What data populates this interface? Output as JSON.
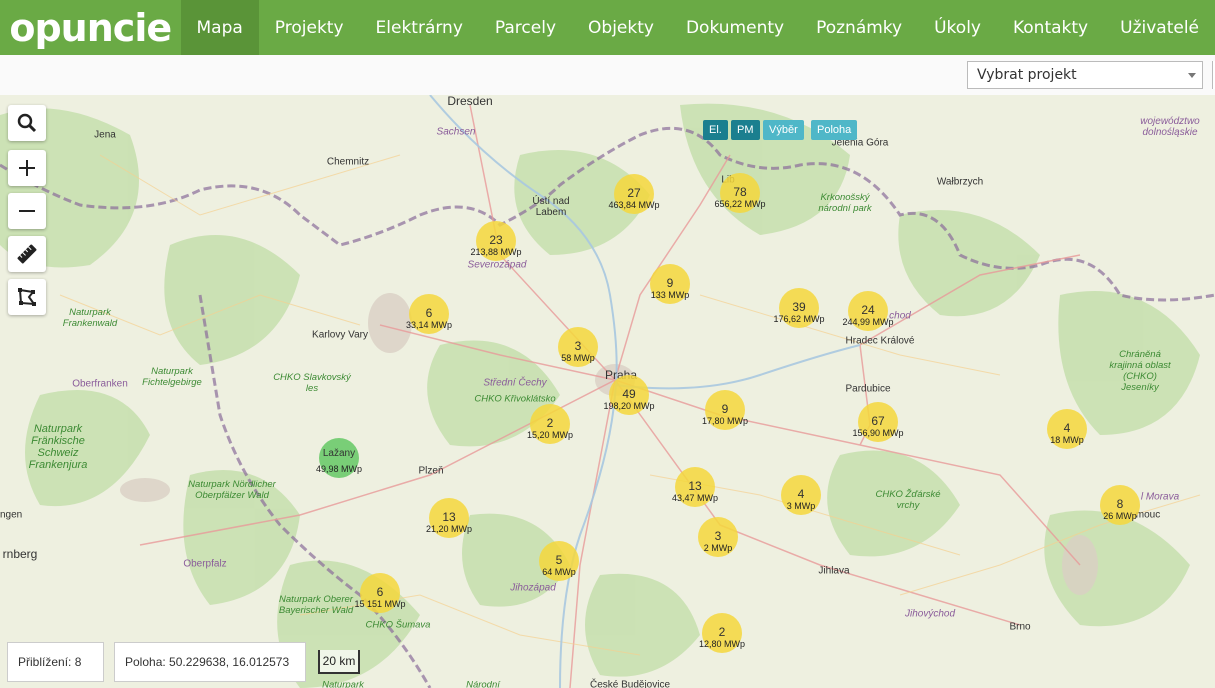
{
  "app": {
    "logo": "opuncie"
  },
  "nav": {
    "items": [
      "Mapa",
      "Projekty",
      "Elektrárny",
      "Parcely",
      "Objekty",
      "Dokumenty",
      "Poznámky",
      "Úkoly",
      "Kontakty",
      "Uživatelé"
    ],
    "active": "Mapa"
  },
  "project_select": {
    "value": "Vybrat projekt"
  },
  "layers": {
    "el": "El.",
    "pm": "PM",
    "vyber": "Výběr",
    "poloha": "Poloha"
  },
  "places": {
    "dresden": "Dresden",
    "chemnitz": "Chemnitz",
    "jena": "Jena",
    "usti": "Ústí nad Labem",
    "karlovy_vary": "Karlovy Vary",
    "praha": "Praha",
    "plzen": "Plzeň",
    "pardubice": "Pardubice",
    "hradec": "Hradec Králové",
    "jihlava": "Jihlava",
    "brno": "Brno",
    "walbrzych": "Wałbrzych",
    "jelenia": "Jelenia Góra",
    "oberfranken": "Oberfranken",
    "oberpfalz": "Oberpfalz",
    "rnberg": "rnberg",
    "ringen": "ringen",
    "ingen": "ingen",
    "ceske": "České Budějovice",
    "dolno": "województwo dolnośląskie",
    "severozapad": "Severozápad",
    "sachsen": "Sachsen",
    "stredni": "Střední Čechy",
    "jihozapad": "Jihozápad",
    "jihovychod": "Jihovýchod",
    "morava": "l Morava",
    "olomouc": "mouc",
    "liberec": "Lib",
    "chod": "chod",
    "narodni": "Národní"
  },
  "areas": {
    "frankenwald": "Naturpark Frankenwald",
    "fichtelgebirge": "Naturpark Fichtelgebirge",
    "slavkovsky": "CHKO Slavkovský les",
    "krivoklatsko": "CHKO Křivoklátsko",
    "krkonosssky": "Krkonošský národní park",
    "schweiz": "Naturpark Fränkische Schweiz Frankenjura",
    "nordl": "Naturpark Nördlicher Oberpfälzer Wald",
    "oberer": "Naturpark Oberer Bayerischer Wald",
    "sumava": "CHKO Šumava",
    "zdarske": "CHKO Žďárské vrchy",
    "jeseniky": "Chráněná krajinná oblast (CHKO) Jeseníky",
    "naturpark_bottom": "Naturpark"
  },
  "clusters": [
    {
      "count": "27",
      "power": "463,84 MWp"
    },
    {
      "count": "78",
      "power": "656,22 MWp"
    },
    {
      "count": "23",
      "power": "213,88 MWp"
    },
    {
      "count": "9",
      "power": "133 MWp"
    },
    {
      "count": "39",
      "power": "176,62 MWp"
    },
    {
      "count": "24",
      "power": "244,99 MWp"
    },
    {
      "count": "6",
      "power": "33,14 MWp"
    },
    {
      "count": "3",
      "power": "58 MWp"
    },
    {
      "count": "49",
      "power": "198,20 MWp"
    },
    {
      "count": "2",
      "power": "15,20 MWp"
    },
    {
      "count": "9",
      "power": "17,80 MWp"
    },
    {
      "count": "67",
      "power": "156,90 MWp"
    },
    {
      "count": "4",
      "power": "18 MWp"
    },
    {
      "count": "Lažany",
      "power": "49,98 MWp"
    },
    {
      "count": "13",
      "power": "43,47 MWp"
    },
    {
      "count": "4",
      "power": "3 MWp"
    },
    {
      "count": "8",
      "power": "26 MWp"
    },
    {
      "count": "13",
      "power": "21,20 MWp"
    },
    {
      "count": "3",
      "power": "2 MWp"
    },
    {
      "count": "5",
      "power": "64 MWp"
    },
    {
      "count": "6",
      "power": "15 151 MWp"
    },
    {
      "count": "2",
      "power": "12,80 MWp"
    }
  ],
  "status": {
    "zoom_label": "Přiblížení: 8",
    "position_label": "Poloha: 50.229638, 16.012573",
    "scale_label": "20 km"
  },
  "icons": [
    "search-icon",
    "zoom-in-icon",
    "zoom-out-icon",
    "ruler-icon",
    "polygon-icon"
  ],
  "colors": {
    "brand_green": "#6aaa45",
    "cluster_yellow": "#f5d73c",
    "layer_teal": "#1b7f8f",
    "layer_light": "#4fb7c8"
  }
}
